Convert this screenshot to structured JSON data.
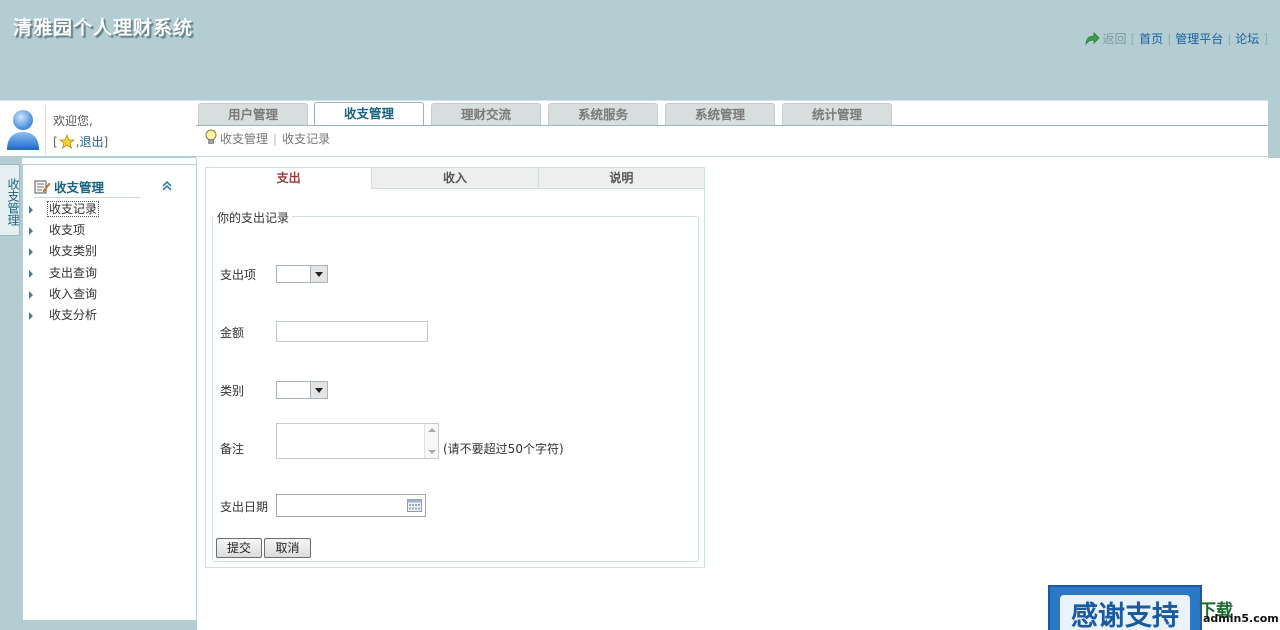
{
  "app": {
    "title": "清雅园个人理财系统"
  },
  "toplinks": {
    "back": "返回",
    "bracket_open": "[",
    "home": "首页",
    "sep": "|",
    "admin": "管理平台",
    "forum": "论坛",
    "bracket_close": "]"
  },
  "user": {
    "welcome": "欢迎您,",
    "bracket_open": "[",
    "comma": ",",
    "logout": "退出",
    "bracket_close": "]"
  },
  "main_tabs": [
    "用户管理",
    "收支管理",
    "理财交流",
    "系统服务",
    "系统管理",
    "统计管理"
  ],
  "active_main_tab": "收支管理",
  "breadcrumb": {
    "section": "收支管理",
    "sep": "|",
    "page": "收支记录"
  },
  "left_strip_label": "收支管理",
  "left_menu": {
    "title": "收支管理",
    "items": [
      "收支记录",
      "收支项",
      "收支类别",
      "支出查询",
      "收入查询",
      "收支分析"
    ],
    "selected": "收支记录"
  },
  "panel": {
    "tabs": [
      "支出",
      "收入",
      "说明"
    ],
    "active_tab": "支出",
    "legend": "你的支出记录",
    "fields": {
      "item_label": "支出项",
      "item_value": "",
      "amount_label": "金额",
      "amount_value": "",
      "category_label": "类别",
      "category_value": "",
      "note_label": "备注",
      "note_value": "",
      "note_hint": "(请不要超过50个字符)",
      "date_label": "支出日期",
      "date_value": ""
    },
    "buttons": {
      "submit": "提交",
      "cancel": "取消"
    }
  },
  "watermark": {
    "main": "感谢支持",
    "side": "下载",
    "site": "admin5.com"
  },
  "colors": {
    "header_bg": "#b3cdd3",
    "link": "#1a5fa0",
    "active_tab_text": "#1a6480",
    "active_panel_tab": "#9b3a3a"
  }
}
